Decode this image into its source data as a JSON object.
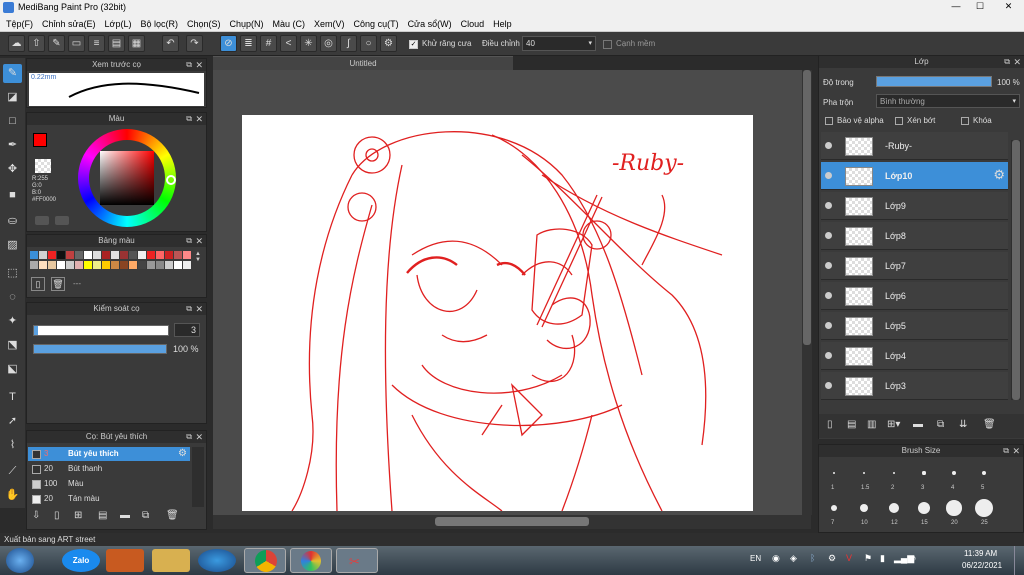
{
  "app": {
    "title": "MediBang Paint Pro (32bit)",
    "minimize": "—",
    "maximize": "☐",
    "close": "✕"
  },
  "menu": [
    "Tệp(F)",
    "Chỉnh sửa(E)",
    "Lớp(L)",
    "Bộ lọc(R)",
    "Chọn(S)",
    "Chụp(N)",
    "Màu (C)",
    "Xem(V)",
    "Công cụ(T)",
    "Cửa sổ(W)",
    "Cloud",
    "Help"
  ],
  "toolbar": {
    "antialias_label": "Khử răng cưa",
    "adjust_label": "Điều chỉnh",
    "adjust_value": "40",
    "edge_label": "Cạnh mềm"
  },
  "brush_preview": {
    "title": "Xem trước cọ",
    "size_label": "0.22mm"
  },
  "color_panel": {
    "title": "Màu",
    "r": "R:255",
    "g": "G:0",
    "b": "B:0",
    "hex": "#FF0000",
    "primary": "#ff0000"
  },
  "palette": {
    "title": "Bảng màu",
    "text": "---",
    "colors": [
      "#3a8fd8",
      "#d0d0d0",
      "#ee2222",
      "#111111",
      "#c04040",
      "#666666",
      "#ffffff",
      "#dddddd",
      "#aa2222",
      "#e0e0e0",
      "#993333",
      "#555555",
      "#f0f0f0",
      "#ee2222",
      "#ff6666",
      "#cc2222",
      "#bb5555",
      "#ff8888",
      "#aaaaaa",
      "#ffe0c0",
      "#e8c8a0",
      "#ffffff",
      "#cccccc",
      "#e0b0b0",
      "#ffff00",
      "#eeee88",
      "#ffcc00",
      "#cc8844",
      "#884422",
      "#ffaa66",
      "#444444",
      "#999999",
      "#888888",
      "#cccccc",
      "#ffffff",
      "#eeeeee"
    ]
  },
  "brush_control": {
    "title": "Kiểm soát cọ",
    "size": "3",
    "opacity": "100 %"
  },
  "brush_list": {
    "title": "Cọ: Bút yêu thích",
    "items": [
      {
        "num": "3",
        "name": "Bút yêu thích"
      },
      {
        "num": "20",
        "name": "Bút thanh"
      },
      {
        "num": "100",
        "name": "Màu"
      },
      {
        "num": "20",
        "name": "Tán màu"
      }
    ]
  },
  "document": {
    "tab": "Untitled",
    "signature": "-Ruby-"
  },
  "layers": {
    "title": "Lớp",
    "opacity_label": "Độ trong",
    "opacity_value": "100 %",
    "blend_label": "Pha trộn",
    "blend_value": "Bình thường",
    "protect_alpha": "Bảo vệ alpha",
    "clipping": "Xén bớt",
    "lock": "Khóa",
    "items": [
      "-Ruby-",
      "Lớp10",
      "Lớp9",
      "Lớp8",
      "Lớp7",
      "Lớp6",
      "Lớp5",
      "Lớp4",
      "Lớp3"
    ]
  },
  "brush_size": {
    "title": "Brush Size",
    "sizes": [
      "1",
      "1.5",
      "2",
      "3",
      "4",
      "5",
      "7",
      "10",
      "12",
      "15",
      "20",
      "25"
    ]
  },
  "status": "Xuất bản sang ART street",
  "taskbar": {
    "lang": "EN",
    "time": "11:39 AM",
    "date": "06/22/2021",
    "zalo": "Zalo"
  }
}
